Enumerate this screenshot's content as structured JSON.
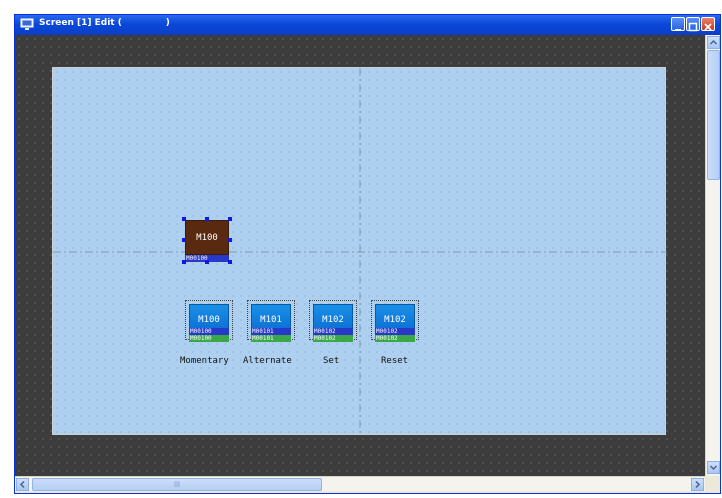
{
  "window": {
    "title": "Screen [1] Edit (              )",
    "controls": [
      "minimize-icon",
      "restore-icon",
      "close-icon"
    ]
  },
  "lamp": {
    "label": "M100",
    "tag": "M00100"
  },
  "switches": [
    {
      "label": "M100",
      "tag_top": "M00100",
      "tag_bottom": "M00100",
      "caption": "Momentary"
    },
    {
      "label": "M101",
      "tag_top": "M00101",
      "tag_bottom": "M00101",
      "caption": "Alternate"
    },
    {
      "label": "M102",
      "tag_top": "M00102",
      "tag_bottom": "M00102",
      "caption": "Set"
    },
    {
      "label": "M102",
      "tag_top": "M00102",
      "tag_bottom": "M00102",
      "caption": "Reset"
    }
  ],
  "scrollbar": {
    "h_thumb_grip": "|||"
  },
  "colors": {
    "title_bar": "#0a48d8",
    "workspace": "#3d3d3d",
    "screen_bg": "#aed0f0",
    "switch_face": "#0a6ad0",
    "lamp_face": "#5a2a10"
  }
}
